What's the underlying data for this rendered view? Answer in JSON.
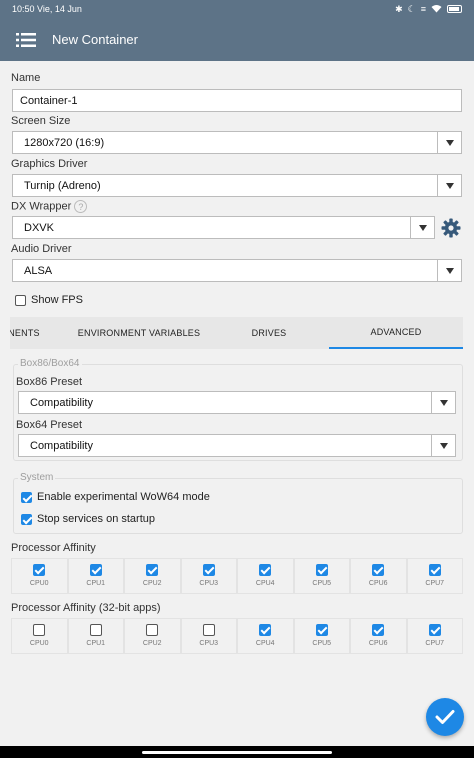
{
  "status_bar": {
    "time": "10:50 Vie, 14 Jun",
    "icons": [
      "bluetooth-icon",
      "moon-icon",
      "vibrate-icon",
      "wifi-icon",
      "battery-icon"
    ]
  },
  "app_bar": {
    "title": "New Container",
    "menu_icon": "menu-icon"
  },
  "form": {
    "name_label": "Name",
    "name_value": "Container-1",
    "screen_size_label": "Screen Size",
    "screen_size_value": "1280x720 (16:9)",
    "graphics_driver_label": "Graphics Driver",
    "graphics_driver_value": "Turnip (Adreno)",
    "dx_wrapper_label": "DX Wrapper",
    "dx_wrapper_help": "?",
    "dx_wrapper_value": "DXVK",
    "audio_driver_label": "Audio Driver",
    "audio_driver_value": "ALSA",
    "show_fps_label": "Show FPS",
    "show_fps_checked": false
  },
  "tabs": [
    {
      "label": "NENTS",
      "active": false
    },
    {
      "label": "ENVIRONMENT VARIABLES",
      "active": false
    },
    {
      "label": "DRIVES",
      "active": false
    },
    {
      "label": "ADVANCED",
      "active": true
    }
  ],
  "advanced": {
    "box_group_title": "Box86/Box64",
    "box86_label": "Box86 Preset",
    "box86_value": "Compatibility",
    "box64_label": "Box64 Preset",
    "box64_value": "Compatibility",
    "system_group_title": "System",
    "wow64_label": "Enable experimental WoW64 mode",
    "wow64_checked": true,
    "stop_services_label": "Stop services on startup",
    "stop_services_checked": true,
    "affinity_label": "Processor Affinity",
    "affinity": [
      {
        "cpu": "CPU0",
        "checked": true
      },
      {
        "cpu": "CPU1",
        "checked": true
      },
      {
        "cpu": "CPU2",
        "checked": true
      },
      {
        "cpu": "CPU3",
        "checked": true
      },
      {
        "cpu": "CPU4",
        "checked": true
      },
      {
        "cpu": "CPU5",
        "checked": true
      },
      {
        "cpu": "CPU6",
        "checked": true
      },
      {
        "cpu": "CPU7",
        "checked": true
      }
    ],
    "affinity32_label": "Processor Affinity (32-bit apps)",
    "affinity32": [
      {
        "cpu": "CPU0",
        "checked": false
      },
      {
        "cpu": "CPU1",
        "checked": false
      },
      {
        "cpu": "CPU2",
        "checked": false
      },
      {
        "cpu": "CPU3",
        "checked": false
      },
      {
        "cpu": "CPU4",
        "checked": true
      },
      {
        "cpu": "CPU5",
        "checked": true
      },
      {
        "cpu": "CPU6",
        "checked": true
      },
      {
        "cpu": "CPU7",
        "checked": true
      }
    ]
  },
  "fab": {
    "icon": "check-icon"
  },
  "colors": {
    "app_bar": "#5d7387",
    "accent": "#1e88e5"
  }
}
